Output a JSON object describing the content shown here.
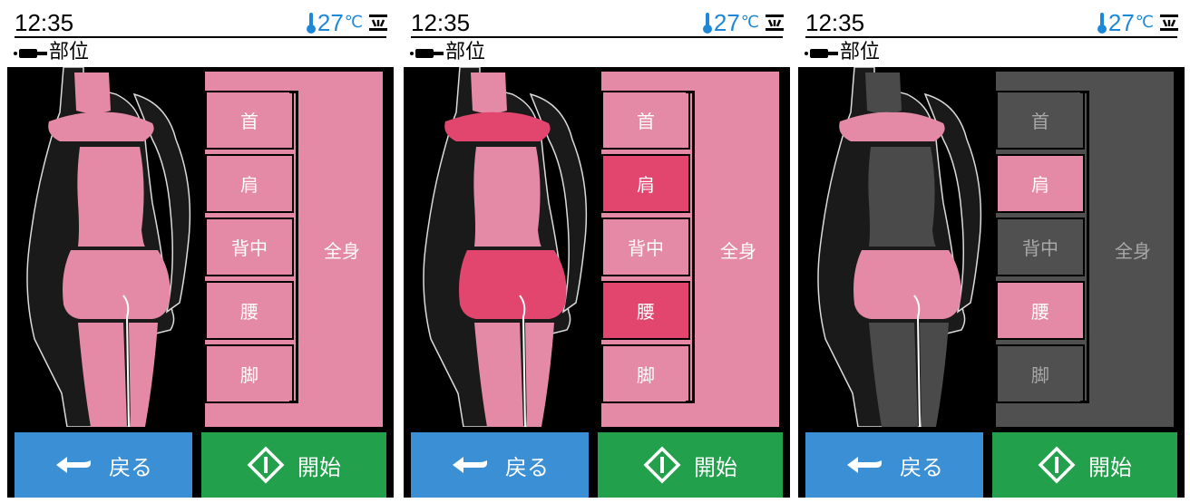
{
  "screens": [
    {
      "time": "12:35",
      "temperature": "27",
      "temperature_unit": "℃",
      "title": "部位",
      "parts": [
        {
          "label": "首",
          "state": "selected"
        },
        {
          "label": "肩",
          "state": "selected"
        },
        {
          "label": "背中",
          "state": "selected"
        },
        {
          "label": "腰",
          "state": "selected"
        },
        {
          "label": "脚",
          "state": "selected"
        }
      ],
      "whole_body": {
        "label": "全身",
        "state": "selected"
      },
      "back_label": "戻る",
      "start_label": "開始"
    },
    {
      "time": "12:35",
      "temperature": "27",
      "temperature_unit": "℃",
      "title": "部位",
      "parts": [
        {
          "label": "首",
          "state": "selected"
        },
        {
          "label": "肩",
          "state": "highlight"
        },
        {
          "label": "背中",
          "state": "selected"
        },
        {
          "label": "腰",
          "state": "highlight"
        },
        {
          "label": "脚",
          "state": "selected"
        }
      ],
      "whole_body": {
        "label": "全身",
        "state": "selected"
      },
      "back_label": "戻る",
      "start_label": "開始"
    },
    {
      "time": "12:35",
      "temperature": "27",
      "temperature_unit": "℃",
      "title": "部位",
      "parts": [
        {
          "label": "首",
          "state": "off"
        },
        {
          "label": "肩",
          "state": "selected"
        },
        {
          "label": "背中",
          "state": "off"
        },
        {
          "label": "腰",
          "state": "selected"
        },
        {
          "label": "脚",
          "state": "off"
        }
      ],
      "whole_body": {
        "label": "全身",
        "state": "off"
      },
      "back_label": "戻る",
      "start_label": "開始"
    }
  ],
  "colors": {
    "selected": "#e48aa6",
    "highlight": "#e2466e",
    "off": "#505050",
    "label_on": "#ffffff",
    "label_off": "#a8a8a8",
    "temperature": "#1e88d8",
    "back_button": "#3b8fd4",
    "start_button": "#23a04b"
  },
  "icons": [
    "thermometer-icon",
    "heater-icon",
    "plug-icon",
    "back-arrow-icon",
    "start-diamond-icon"
  ]
}
